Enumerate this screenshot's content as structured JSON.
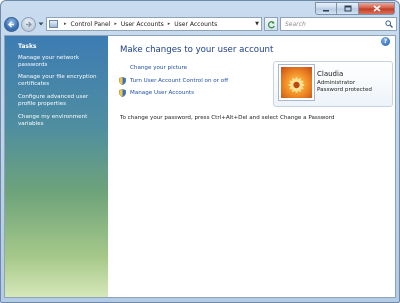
{
  "address_bar": {
    "crumbs": [
      "Control Panel",
      "User Accounts",
      "User Accounts"
    ]
  },
  "search": {
    "placeholder": "Search"
  },
  "sidebar": {
    "title": "Tasks",
    "items": [
      {
        "label": "Manage your network passwords"
      },
      {
        "label": "Manage your file encryption certificates"
      },
      {
        "label": "Configure advanced user profile properties"
      },
      {
        "label": "Change my environment variables"
      }
    ]
  },
  "main": {
    "heading": "Make changes to your user account",
    "links": [
      {
        "label": "Change your picture"
      },
      {
        "label": "Turn User Account Control on or off",
        "icon": "shield-icon"
      },
      {
        "label": "Manage User Accounts",
        "icon": "shield-icon"
      }
    ],
    "hint": "To change your password, press Ctrl+Alt+Del and select Change a Password"
  },
  "account": {
    "name": "Claudia",
    "role": "Administrator",
    "status": "Password protected"
  },
  "colors": {
    "link": "#1f4ea5",
    "heading": "#1e3f8a",
    "sidebar_top": "#3d7cb3",
    "sidebar_bottom": "#d6e8ba"
  }
}
